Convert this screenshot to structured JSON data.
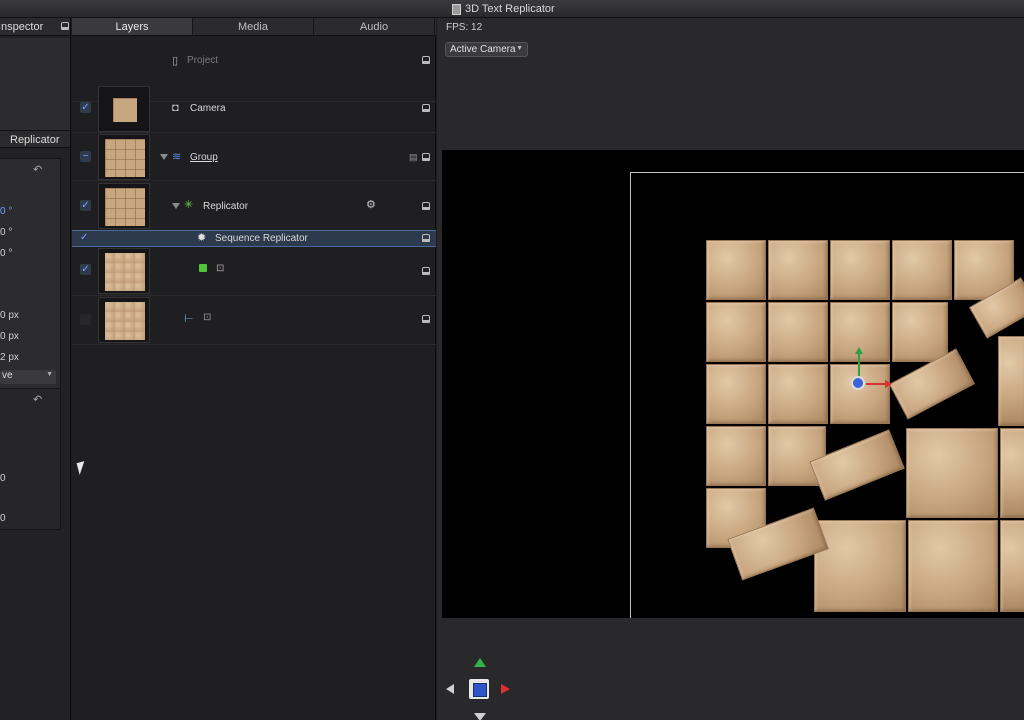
{
  "window": {
    "title": "3D Text Replicator"
  },
  "inspector": {
    "header": "Inspector",
    "tab_label": "Replicator",
    "params": [
      {
        "value": "0 °",
        "blue": true
      },
      {
        "value": "0 °",
        "blue": false
      },
      {
        "value": "0 °",
        "blue": false
      },
      {
        "value": "0 px",
        "blue": false
      },
      {
        "value": "0 px",
        "blue": false
      },
      {
        "value": "2 px",
        "blue": false
      }
    ],
    "popup_value": "ve",
    "lower_values": [
      "0",
      "0"
    ],
    "undo_glyph": "↶"
  },
  "layers": {
    "tabs": [
      "Layers",
      "Media",
      "Audio"
    ],
    "active_tab": "Layers",
    "rows": {
      "project": "Project",
      "camera": "Camera",
      "group": "Group",
      "replicator": "Replicator",
      "sequence": "Sequence Replicator"
    }
  },
  "canvas": {
    "fps_label": "FPS: 12",
    "camera_popup": "Active Camera"
  },
  "icons": {
    "check": "✓",
    "gear": "⚙",
    "camera": "📷",
    "replicator": "✳",
    "sequence": "✹"
  },
  "colors": {
    "selection": "#2d3a4e",
    "gizmo_x": "#d93030",
    "gizmo_y": "#2ea043",
    "gizmo_center": "#3b63d8"
  }
}
